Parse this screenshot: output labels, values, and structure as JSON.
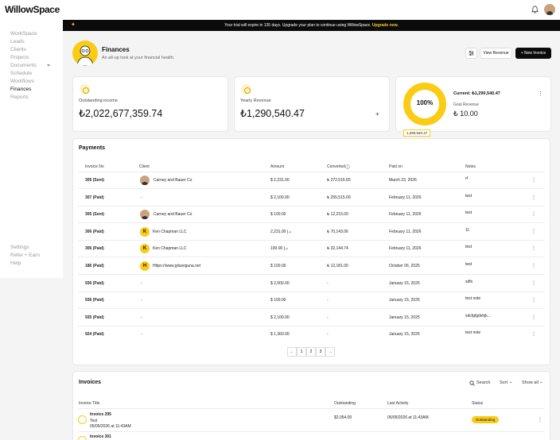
{
  "app": {
    "logo": "WillowSpace"
  },
  "banner": {
    "text": "Your trial will expire in 135 days. Upgrade your plan to continue using WillowSpace.",
    "link": "Upgrade now."
  },
  "sidebar": {
    "items": [
      "WorkSpace",
      "Leads",
      "Clients",
      "Projects",
      "Documents",
      "Schedule",
      "Workflows",
      "Finances",
      "Reports"
    ],
    "bottom": [
      "Settings",
      "Refer + Earn",
      "Help"
    ]
  },
  "header": {
    "title": "Finances",
    "subtitle": "An all-up look at your financial health.",
    "view_revenue": "View Revenue",
    "new_invoice": "New Invoice",
    "new_invoice_plus": "+"
  },
  "stats": {
    "outstanding": {
      "label": "Outstanding income",
      "value": "₺2,022,677,359.74"
    },
    "yearly": {
      "label": "Yearly Revenue",
      "value": "₺1,290,540.47",
      "plus": "+"
    },
    "goal": {
      "percent": "100%",
      "tooltip": "1,290,540.47",
      "current": "Current: ₺1,290,540.47",
      "goal_label": "Goal Revenue",
      "goal_value": "₺ 10.00",
      "progress": 1.0
    }
  },
  "payments": {
    "title": "Payments",
    "columns": [
      "Invoice No",
      "Client",
      "Amount",
      "Converted",
      "Paid on",
      "Notes"
    ],
    "rows": [
      {
        "invoice": "305 (Sent)",
        "client": "Carney and Bauer Co",
        "avatar": "photo",
        "amount": "$ 2,231.00",
        "converted": "₺ 272,516.65",
        "paid": "March 23, 2026",
        "notes": "rf"
      },
      {
        "invoice": "307 (Paid)",
        "client": "-",
        "avatar": "",
        "amount": "$ 2,100.00",
        "converted": "₺ 255,515.00",
        "paid": "February 11, 2026",
        "notes": "test"
      },
      {
        "invoice": "305 (Sent)",
        "client": "Carney and Bauer Co",
        "avatar": "photo",
        "amount": "$ 100.00",
        "converted": "₺ 12,215.00",
        "paid": "February 11, 2026",
        "notes": "test"
      },
      {
        "invoice": "306 (Paid)",
        "client": "Ken Chapman LLC",
        "avatar": "K",
        "amount": "2,231.00 د.إ",
        "converted": "₺ 70,143.06",
        "paid": "February 11, 2026",
        "notes": "11"
      },
      {
        "invoice": "306 (Paid)",
        "client": "Ken Chapman LLC",
        "avatar": "K",
        "amount": "100.00 د.إ",
        "converted": "₺ 32,144.74",
        "paid": "February 11, 2026",
        "notes": "test"
      },
      {
        "invoice": "186 (Paid)",
        "client": "Https://www.jybaxiguna.net",
        "avatar": "H",
        "amount": "$ 100.00",
        "converted": "₺ 12,181.00",
        "paid": "October 06, 2025",
        "notes": "test"
      },
      {
        "invoice": "936 (Paid)",
        "client": "-",
        "avatar": "",
        "amount": "$ 2,000.00",
        "converted": "-",
        "paid": "January 15, 2025",
        "notes": "sdfs"
      },
      {
        "invoice": "936 (Paid)",
        "client": "-",
        "avatar": "",
        "amount": "$ 100.00",
        "converted": "-",
        "paid": "January 15, 2025",
        "notes": "test note"
      },
      {
        "invoice": "935 (Paid)",
        "client": "-",
        "avatar": "",
        "amount": "$ 2,100.00",
        "converted": "-",
        "paid": "January 15, 2025",
        "notes": "xdcfgfgdxhjk..."
      },
      {
        "invoice": "924 (Paid)",
        "client": "-",
        "avatar": "",
        "amount": "$ 1,360.00",
        "converted": "-",
        "paid": "January 15, 2025",
        "notes": "test note"
      }
    ],
    "pagination": [
      "←",
      "1",
      "2",
      "3",
      "→"
    ]
  },
  "invoices": {
    "title": "Invoices",
    "search": "Search",
    "sort": "Sort",
    "show": "Show all",
    "columns": [
      "Invoice Title",
      "Outstanding",
      "Last Activity",
      "Status"
    ],
    "rows": [
      {
        "title": "Invoice 295",
        "sub": "Test",
        "date": "05/05/2026 at 11:43AM",
        "outstanding": "$2,054.00",
        "activity": "05/05/2026 at 11:43AM",
        "status": "Outstanding"
      },
      {
        "title": "Invoice 301"
      }
    ]
  },
  "colors": {
    "accent": "#facc15",
    "dark": "#0b0b0b"
  },
  "icons": [
    "bell-icon",
    "plus-icon",
    "settings-sliders-icon",
    "target-icon",
    "kebab-icon",
    "search-icon",
    "chevron-down-icon"
  ]
}
